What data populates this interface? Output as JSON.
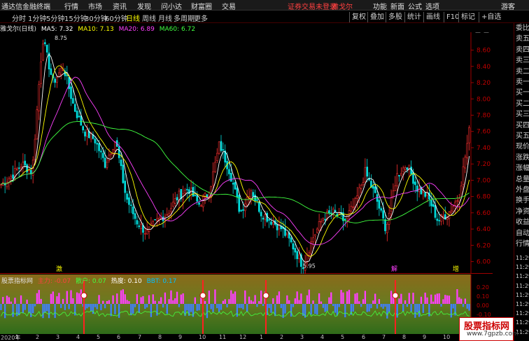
{
  "titlebar": {
    "app_name": "通达信金融终端",
    "menu": [
      "行情",
      "市场",
      "资讯",
      "发现",
      "问小达",
      "财富圈",
      "交易"
    ],
    "warning": "证券交易未登录",
    "stock_short": "雅戈尔",
    "right_items": [
      "功能",
      "新面",
      "公式",
      "选项"
    ],
    "guest": "游客"
  },
  "toolbar": {
    "periods": [
      "分时",
      "1分钟",
      "5分钟",
      "15分钟",
      "30分钟",
      "60分钟",
      "日线",
      "周线",
      "月线",
      "多周期",
      "更多"
    ],
    "active_period": "日线",
    "tools": [
      "复权",
      "叠加",
      "多股",
      "统计",
      "画线",
      "F10",
      "标记",
      "+自选"
    ]
  },
  "chart_header": {
    "stock": "雅戈尔(日线)",
    "ma": [
      {
        "label": "MA5: 7.32",
        "color": "#ffffff"
      },
      {
        "label": "MA10: 7.13",
        "color": "#ffff00"
      },
      {
        "label": "MA20: 6.89",
        "color": "#ff40ff"
      },
      {
        "label": "MA60: 6.72",
        "color": "#40ff40"
      }
    ]
  },
  "indicator_header": {
    "name": "股票指标网",
    "items": [
      {
        "label": "主力: -0.07",
        "color": "#ff4040"
      },
      {
        "label": "散户: 0.07",
        "color": "#40ff40"
      },
      {
        "label": "热度: 0.10",
        "color": "#ffffff"
      },
      {
        "label": "BBT: 0.17",
        "color": "#00c0ff"
      }
    ],
    "axis_ticks": [
      "0.20",
      "0.10",
      "0.00",
      "-0.10"
    ]
  },
  "chart_data": {
    "type": "candlestick",
    "y_ticks": [
      8.6,
      8.4,
      8.2,
      8.0,
      7.8,
      7.6,
      7.4,
      7.2,
      7.0,
      6.8,
      6.6,
      6.4,
      6.2,
      6.0
    ],
    "ylim": [
      5.85,
      8.82
    ],
    "annotations": [
      {
        "text": "8.75",
        "value": 8.75
      },
      {
        "text": "5.95",
        "value": 5.95
      }
    ],
    "x_ticks": [
      "2020年",
      "1",
      "2",
      "3",
      "4",
      "5",
      "6",
      "7",
      "8",
      "9",
      "10",
      "11",
      "12",
      "1",
      "2",
      "3",
      "4",
      "5",
      "6",
      "7",
      "8",
      "9",
      "10"
    ],
    "close_path": [
      6.95,
      7.05,
      7.2,
      7.1,
      8.75,
      8.2,
      8.4,
      7.9,
      7.6,
      7.5,
      7.2,
      7.5,
      6.8,
      6.5,
      6.35,
      6.5,
      6.6,
      6.8,
      6.9,
      6.7,
      6.85,
      7.45,
      7.1,
      6.6,
      6.9,
      6.6,
      6.5,
      6.4,
      6.2,
      5.95,
      6.3,
      6.55,
      6.6,
      6.5,
      6.7,
      7.1,
      6.8,
      6.4,
      7.05,
      7.2,
      6.9,
      6.8,
      6.5,
      6.6,
      6.8,
      7.6
    ],
    "event_marks": [
      "激",
      "解",
      "增"
    ]
  },
  "right_panel": {
    "labels": [
      "委比",
      "卖五",
      "卖四",
      "卖三",
      "卖二",
      "卖一",
      "买一",
      "买二",
      "买三",
      "买四",
      "买五",
      "现价",
      "涨跌",
      "涨幅",
      "总量",
      "外盘",
      "换手",
      "净资",
      "收益",
      "自动",
      "行情"
    ],
    "times": [
      "11:29",
      "11:29",
      "11:29",
      "11:29",
      "11:29",
      "11:29",
      "11:29",
      "11:29",
      "11:29"
    ]
  },
  "watermark": {
    "line1": "股票指标网",
    "line2": "www.7gpzb.com"
  }
}
